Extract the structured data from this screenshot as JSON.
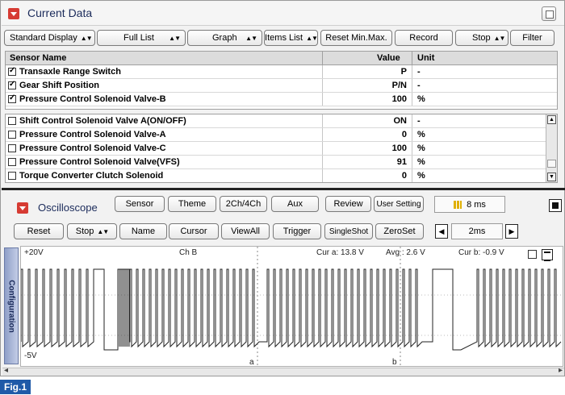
{
  "current_data": {
    "title": "Current Data",
    "toolbar": {
      "display_select": "Standard Display",
      "list_select": "Full List",
      "graph_select": "Graph",
      "items_list": "Items List",
      "reset_minmax": "Reset Min.Max.",
      "record": "Record",
      "stop_select": "Stop",
      "filter": "Filter"
    },
    "columns": {
      "name": "Sensor Name",
      "value": "Value",
      "unit": "Unit"
    },
    "fixed_rows": [
      {
        "name": "Transaxle Range Switch",
        "value": "P",
        "unit": "-",
        "checked": true
      },
      {
        "name": "Gear Shift Position",
        "value": "P/N",
        "unit": "-",
        "checked": true
      },
      {
        "name": "Pressure Control Solenoid Valve-B",
        "value": "100",
        "unit": "%",
        "checked": true
      }
    ],
    "rows": [
      {
        "name": "Shift Control Solenoid Valve A(ON/OFF)",
        "value": "ON",
        "unit": "-",
        "checked": false
      },
      {
        "name": "Pressure Control Solenoid Valve-A",
        "value": "0",
        "unit": "%",
        "checked": false
      },
      {
        "name": "Pressure Control Solenoid Valve-C",
        "value": "100",
        "unit": "%",
        "checked": false
      },
      {
        "name": "Pressure Control Solenoid Valve(VFS)",
        "value": "91",
        "unit": "%",
        "checked": false
      },
      {
        "name": "Torque Converter Clutch Solenoid",
        "value": "0",
        "unit": "%",
        "checked": false
      }
    ]
  },
  "oscilloscope": {
    "title": "Oscilloscope",
    "top_buttons": [
      "Sensor",
      "Theme",
      "2Ch/4Ch",
      "Aux",
      "Review",
      "User Setting"
    ],
    "timebase_readout": "8 ms",
    "bottom_buttons": {
      "reset": "Reset",
      "stop": "Stop",
      "name": "Name",
      "cursor": "Cursor",
      "viewall": "ViewAll",
      "trigger": "Trigger",
      "singleshot": "SingleShot",
      "zeroset": "ZeroSet"
    },
    "time_div": "2ms",
    "config_tab": "Configuration",
    "scope": {
      "top_voltage": "+20V",
      "bottom_voltage": "-5V",
      "channel": "Ch B",
      "cur_a": "Cur a: 13.8 V",
      "avg": "Avg : 2.6 V",
      "cur_b": "Cur b: -0.9 V",
      "cursor_a_marker": "a",
      "cursor_b_marker": "b"
    }
  },
  "figure_label": "Fig.1"
}
